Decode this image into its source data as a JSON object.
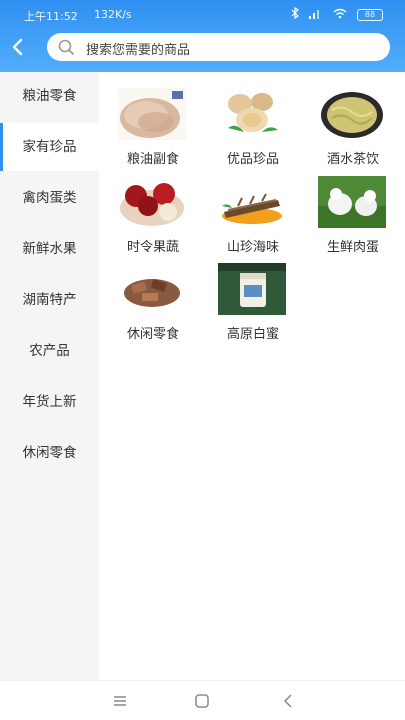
{
  "status_bar": {
    "time": "上午11:52",
    "speed": "132K/s",
    "battery": "88"
  },
  "search": {
    "placeholder": "搜索您需要的商品"
  },
  "sidebar": {
    "items": [
      {
        "label": "粮油零食"
      },
      {
        "label": "家有珍品"
      },
      {
        "label": "禽肉蛋类"
      },
      {
        "label": "新鲜水果"
      },
      {
        "label": "湖南特产"
      },
      {
        "label": "农产品"
      },
      {
        "label": "年货上新"
      },
      {
        "label": "休闲零食"
      }
    ]
  },
  "active_index": 1,
  "products": [
    {
      "label": "粮油副食"
    },
    {
      "label": "优品珍品"
    },
    {
      "label": "酒水茶饮"
    },
    {
      "label": "时令果蔬"
    },
    {
      "label": "山珍海味"
    },
    {
      "label": "生鲜肉蛋"
    },
    {
      "label": "休闲零食"
    },
    {
      "label": "高原白蜜"
    }
  ],
  "colors": {
    "accent": "#2f90f2",
    "sidebar_bg": "#f5f5f5"
  }
}
